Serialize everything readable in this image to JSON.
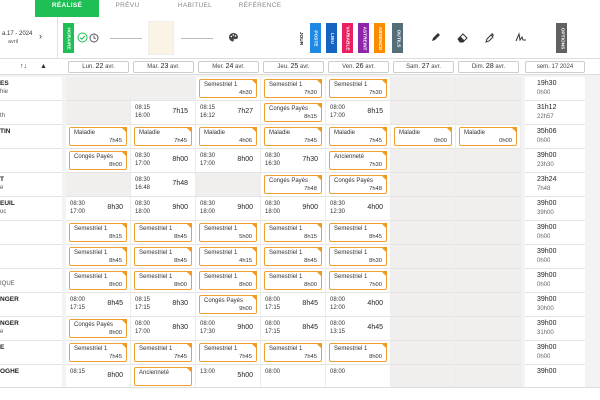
{
  "tabs": [
    "RÉALISÉ",
    "PRÉVU",
    "HABITUEL",
    "RÉFÉRENCE"
  ],
  "week_nav": {
    "label": "a.17 - 2024",
    "month": "avril",
    "chevron": "›"
  },
  "toolbar": {
    "horaire": "HORAIRE",
    "jour": "JOUR",
    "buttons": [
      {
        "label": "POSTE",
        "color": "#1e88e5"
      },
      {
        "label": "LIEU",
        "color": "#1565c0"
      },
      {
        "label": "VARIABLE",
        "color": "#e91e63"
      },
      {
        "label": "ASTREINT",
        "color": "#8e24aa"
      },
      {
        "label": "ABSENCE",
        "color": "#fb8c00"
      },
      {
        "label": "OUTILS",
        "color": "#546e7a"
      }
    ],
    "options": "OPTIONS",
    "icons": [
      "clock-icon",
      "palette-icon",
      "pencil-icon",
      "eraser-icon",
      "eyedropper-icon",
      "signature-icon"
    ]
  },
  "days": [
    {
      "dow": "Lun.",
      "num": "22",
      "mon": "avr."
    },
    {
      "dow": "Mar.",
      "num": "23",
      "mon": "avr."
    },
    {
      "dow": "Mer.",
      "num": "24",
      "mon": "avr."
    },
    {
      "dow": "Jeu.",
      "num": "25",
      "mon": "avr."
    },
    {
      "dow": "Ven.",
      "num": "26",
      "mon": "avr."
    },
    {
      "dow": "Sam.",
      "num": "27",
      "mon": "avr."
    },
    {
      "dow": "Dim.",
      "num": "28",
      "mon": "avr."
    }
  ],
  "week_label": "sem. 17 2024",
  "rows": [
    {
      "name": "ES",
      "sub": "hie",
      "cells": [
        {
          "k": "g"
        },
        {
          "k": "g"
        },
        {
          "k": "b",
          "l": "Semestriel 1",
          "d": "4h30"
        },
        {
          "k": "b",
          "l": "Semestriel 1",
          "d": "7h30"
        },
        {
          "k": "b",
          "l": "Semestriel 1",
          "d": "7h30"
        },
        {
          "k": "g"
        },
        {
          "k": "g"
        }
      ],
      "t1": "19h30",
      "t2": "0h00"
    },
    {
      "name": "",
      "sub": "th",
      "cells": [
        {
          "k": "g"
        },
        {
          "k": "t",
          "s": "08:15\n16:00",
          "d": "7h15"
        },
        {
          "k": "t",
          "s": "08:15\n16:12",
          "d": "7h27"
        },
        {
          "k": "b",
          "l": "Congés Payés",
          "d": "8h15"
        },
        {
          "k": "t",
          "s": "08:00\n17:00",
          "d": "8h15"
        },
        {
          "k": "g"
        },
        {
          "k": "g"
        }
      ],
      "t1": "31h12",
      "t2": "22h57"
    },
    {
      "name": "TIN",
      "sub": "",
      "cells": [
        {
          "k": "b",
          "l": "Maladie",
          "d": "7h45"
        },
        {
          "k": "b",
          "l": "Maladie",
          "d": "7h45"
        },
        {
          "k": "b",
          "l": "Maladie",
          "d": "4h06"
        },
        {
          "k": "b",
          "l": "Maladie",
          "d": "7h45"
        },
        {
          "k": "b",
          "l": "Maladie",
          "d": "7h45"
        },
        {
          "k": "b",
          "l": "Maladie",
          "d": "0h00"
        },
        {
          "k": "b",
          "l": "Maladie",
          "d": "0h00"
        }
      ],
      "t1": "35h06",
      "t2": "0h00"
    },
    {
      "name": "",
      "sub": "",
      "cells": [
        {
          "k": "b",
          "l": "Congés Payés",
          "d": "8h00"
        },
        {
          "k": "t",
          "s": "08:30\n17:00",
          "d": "8h00"
        },
        {
          "k": "t",
          "s": "08:30\n17:00",
          "d": "8h00"
        },
        {
          "k": "t",
          "s": "08:30\n16:30",
          "d": "7h30"
        },
        {
          "k": "b",
          "l": "Ancienneté",
          "d": "7h30"
        },
        {
          "k": "g"
        },
        {
          "k": "g"
        }
      ],
      "t1": "39h00",
      "t2": "23h30"
    },
    {
      "name": "T",
      "sub": "e",
      "cells": [
        {
          "k": "g"
        },
        {
          "k": "t",
          "s": "08:30\n16:48",
          "d": "7h48"
        },
        {
          "k": "g"
        },
        {
          "k": "b",
          "l": "Congés Payés",
          "d": "7h48"
        },
        {
          "k": "b",
          "l": "Congés Payés",
          "d": "7h48"
        },
        {
          "k": "g"
        },
        {
          "k": "g"
        }
      ],
      "t1": "23h24",
      "t2": "7h48"
    },
    {
      "name": "EUIL",
      "sub": "uc",
      "cells": [
        {
          "k": "t",
          "s": "08:30\n17:00",
          "d": "8h30"
        },
        {
          "k": "t",
          "s": "08:30\n18:00",
          "d": "9h00"
        },
        {
          "k": "t",
          "s": "08:30\n18:00",
          "d": "9h00"
        },
        {
          "k": "t",
          "s": "08:30\n18:00",
          "d": "9h00"
        },
        {
          "k": "t",
          "s": "08:30\n12:30",
          "d": "4h00"
        },
        {
          "k": "g"
        },
        {
          "k": "g"
        }
      ],
      "t1": "39h00",
      "t2": "39h00"
    },
    {
      "name": "",
      "sub": "",
      "cells": [
        {
          "k": "b",
          "l": "Semestriel 1",
          "d": "8h15"
        },
        {
          "k": "b",
          "l": "Semestriel 1",
          "d": "8h45"
        },
        {
          "k": "b",
          "l": "Semestriel 1",
          "d": "5h00"
        },
        {
          "k": "b",
          "l": "Semestriel 1",
          "d": "8h15"
        },
        {
          "k": "b",
          "l": "Semestriel 1",
          "d": "8h45"
        },
        {
          "k": "g"
        },
        {
          "k": "g"
        }
      ],
      "t1": "39h00",
      "t2": "0h00"
    },
    {
      "name": "",
      "sub": "",
      "cells": [
        {
          "k": "b",
          "l": "Semestriel 1",
          "d": "8h45"
        },
        {
          "k": "b",
          "l": "Semestriel 1",
          "d": "8h45"
        },
        {
          "k": "b",
          "l": "Semestriel 1",
          "d": "4h15"
        },
        {
          "k": "b",
          "l": "Semestriel 1",
          "d": "8h45"
        },
        {
          "k": "b",
          "l": "Semestriel 1",
          "d": "8h30"
        },
        {
          "k": "g"
        },
        {
          "k": "g"
        }
      ],
      "t1": "39h00",
      "t2": "0h00"
    },
    {
      "name": "",
      "sub": "IQUE",
      "cells": [
        {
          "k": "b",
          "l": "Semestriel 1",
          "d": "8h00"
        },
        {
          "k": "b",
          "l": "Semestriel 1",
          "d": "8h00"
        },
        {
          "k": "b",
          "l": "Semestriel 1",
          "d": "8h00"
        },
        {
          "k": "b",
          "l": "Semestriel 1",
          "d": "8h00"
        },
        {
          "k": "b",
          "l": "Semestriel 1",
          "d": "7h00"
        },
        {
          "k": "g"
        },
        {
          "k": "g"
        }
      ],
      "t1": "39h00",
      "t2": "0h00"
    },
    {
      "name": "NGER",
      "sub": "",
      "cells": [
        {
          "k": "t",
          "s": "08:00\n17:15",
          "d": "8h45"
        },
        {
          "k": "t",
          "s": "08:15\n17:15",
          "d": "8h30"
        },
        {
          "k": "b",
          "l": "Congés Payés",
          "d": "9h00"
        },
        {
          "k": "t",
          "s": "08:00\n17:15",
          "d": "8h45"
        },
        {
          "k": "t",
          "s": "08:00\n12:00",
          "d": "4h00"
        },
        {
          "k": "g"
        },
        {
          "k": "g"
        }
      ],
      "t1": "39h00",
      "t2": "30h00"
    },
    {
      "name": "NGER",
      "sub": "e",
      "cells": [
        {
          "k": "b",
          "l": "Congés Payés",
          "d": "8h00"
        },
        {
          "k": "t",
          "s": "08:00\n17:00",
          "d": "8h30"
        },
        {
          "k": "t",
          "s": "08:00\n17:30",
          "d": "9h00"
        },
        {
          "k": "t",
          "s": "08:00\n17:15",
          "d": "8h45"
        },
        {
          "k": "t",
          "s": "08:00\n13:15",
          "d": "4h45"
        },
        {
          "k": "g"
        },
        {
          "k": "g"
        }
      ],
      "t1": "39h00",
      "t2": "31h00"
    },
    {
      "name": "E",
      "sub": "",
      "cells": [
        {
          "k": "b",
          "l": "Semestriel 1",
          "d": "7h45"
        },
        {
          "k": "b",
          "l": "Semestriel 1",
          "d": "7h45"
        },
        {
          "k": "b",
          "l": "Semestriel 1",
          "d": "7h45"
        },
        {
          "k": "b",
          "l": "Semestriel 1",
          "d": "7h45"
        },
        {
          "k": "b",
          "l": "Semestriel 1",
          "d": "8h00"
        },
        {
          "k": "g"
        },
        {
          "k": "g"
        }
      ],
      "t1": "39h00",
      "t2": "0h00"
    },
    {
      "name": "OGHE",
      "sub": "",
      "cells": [
        {
          "k": "t",
          "s": "08:15\n",
          "d": "8h00"
        },
        {
          "k": "b",
          "l": "Ancienneté",
          "d": ""
        },
        {
          "k": "t",
          "s": "13:00\n",
          "d": "5h00"
        },
        {
          "k": "t",
          "s": "08:00\n",
          "d": ""
        },
        {
          "k": "t",
          "s": "08:00\n",
          "d": ""
        },
        {
          "k": "g"
        },
        {
          "k": "g"
        }
      ],
      "t1": "39h00",
      "t2": ""
    }
  ]
}
